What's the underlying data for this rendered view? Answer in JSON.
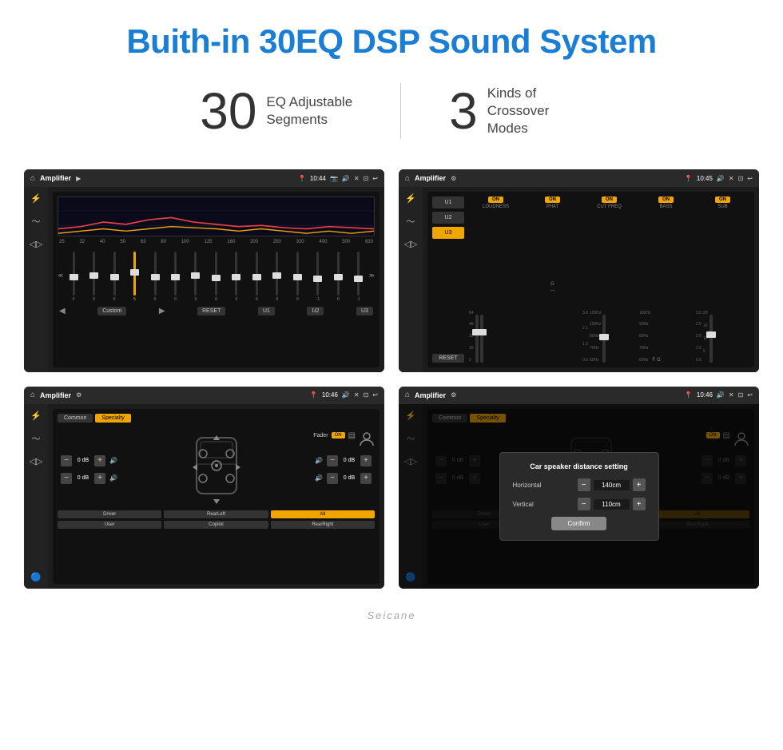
{
  "header": {
    "title": "Buith-in 30EQ DSP Sound System"
  },
  "stats": [
    {
      "number": "30",
      "label": "EQ Adjustable\nSegments"
    },
    {
      "number": "3",
      "label": "Kinds of\nCrossover Modes"
    }
  ],
  "screen1": {
    "title": "Amplifier",
    "time": "10:44",
    "eq_labels": [
      "25",
      "32",
      "40",
      "50",
      "63",
      "80",
      "100",
      "125",
      "160",
      "200",
      "250",
      "320",
      "400",
      "500",
      "630"
    ],
    "fader_values": [
      "0",
      "0",
      "0",
      "5",
      "0",
      "0",
      "0",
      "0",
      "0",
      "0",
      "0",
      "0",
      "-1",
      "0",
      "-1"
    ],
    "fader_positions": [
      50,
      48,
      50,
      40,
      50,
      50,
      48,
      52,
      50,
      50,
      48,
      50,
      55,
      50,
      55
    ],
    "controls": {
      "back": "◀",
      "preset": "Custom",
      "play": "▶",
      "reset": "RESET",
      "u1": "U1",
      "u2": "U2",
      "u3": "U3"
    }
  },
  "screen2": {
    "title": "Amplifier",
    "time": "10:45",
    "presets": [
      "U1",
      "U2",
      "U3"
    ],
    "active_preset": "U3",
    "channels": [
      {
        "name": "LOUDNESS",
        "on": true
      },
      {
        "name": "PHAT",
        "on": true
      },
      {
        "name": "CUT FREQ",
        "on": true
      },
      {
        "name": "BASS",
        "on": true
      },
      {
        "name": "SUB",
        "on": true
      }
    ],
    "reset": "RESET"
  },
  "screen3": {
    "title": "Amplifier",
    "time": "10:46",
    "tabs": [
      "Common",
      "Specialty"
    ],
    "active_tab": "Specialty",
    "fader_label": "Fader",
    "fader_on": "ON",
    "db_values": [
      "0 dB",
      "0 dB",
      "0 dB",
      "0 dB"
    ],
    "presets": [
      "Driver",
      "RearLeft",
      "All",
      "User",
      "Copilot",
      "RearRight"
    ],
    "active_preset": "All"
  },
  "screen4": {
    "title": "Amplifier",
    "time": "10:46",
    "tabs": [
      "Common",
      "Specialty"
    ],
    "active_tab": "Specialty",
    "dialog": {
      "title": "Car speaker distance setting",
      "horizontal_label": "Horizontal",
      "horizontal_value": "140cm",
      "vertical_label": "Vertical",
      "vertical_value": "110cm",
      "confirm_label": "Confirm"
    },
    "db_values": [
      "0 dB",
      "0 dB"
    ],
    "presets": [
      "Driver",
      "RearLeft",
      "All",
      "User",
      "Copilot",
      "RearRight"
    ]
  },
  "brand": "Seicane"
}
